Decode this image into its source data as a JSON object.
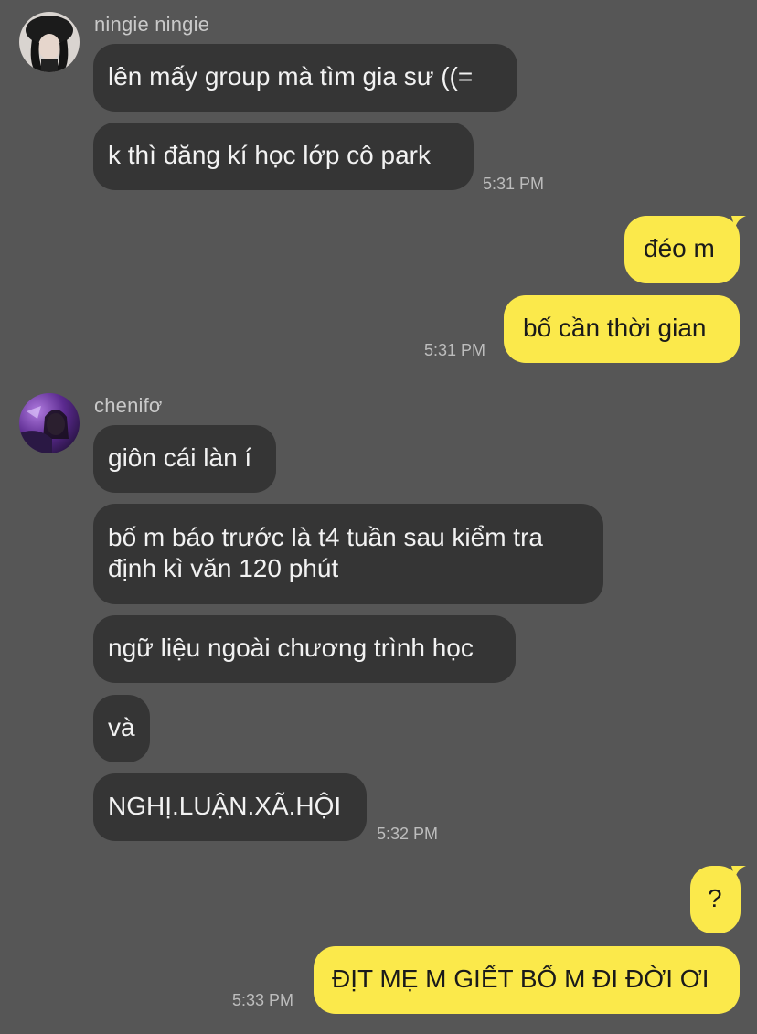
{
  "groups": [
    {
      "sender": "ningie ningie",
      "messages": [
        "lên mấy group mà tìm gia sư ((=",
        "k thì đăng kí học lớp cô park"
      ],
      "time": "5:31 PM"
    },
    {
      "sender": "me",
      "messages": [
        "đéo m",
        "bố cần thời gian"
      ],
      "time": "5:31 PM"
    },
    {
      "sender": "chenifơ",
      "messages": [
        "giôn cái làn í",
        "bố m báo trước là t4 tuần sau kiểm tra định kì văn 120 phút",
        "ngữ liệu ngoài chương trình học",
        "và",
        "NGHỊ.LUẬN.XÃ.HỘI"
      ],
      "time": "5:32 PM"
    },
    {
      "sender": "me",
      "messages": [
        "?",
        "ĐỊT MẸ M GIẾT BỐ M ĐI ĐỜI ƠI"
      ],
      "time": "5:33 PM"
    }
  ],
  "colors": {
    "background": "#565656",
    "incoming_bubble": "#353535",
    "outgoing_bubble": "#fbe94b"
  }
}
